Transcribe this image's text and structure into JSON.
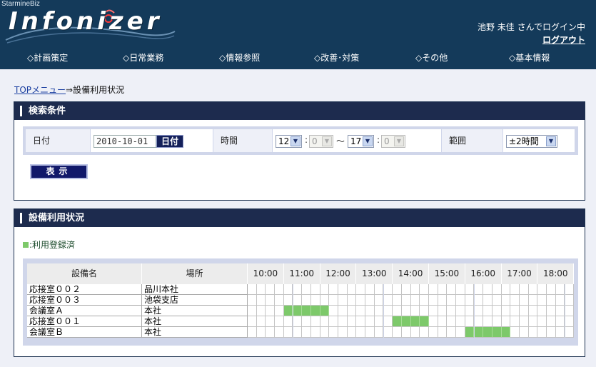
{
  "header": {
    "brand_small": "StarmineBiz",
    "logo_text": "Infonizer",
    "login_status": "池野  未佳 さんでログイン中",
    "logout_label": "ログアウト"
  },
  "nav": {
    "items": [
      {
        "label": "◇計画策定"
      },
      {
        "label": "◇日常業務"
      },
      {
        "label": "◇情報参照"
      },
      {
        "label": "◇改善･対策"
      },
      {
        "label": "◇その他"
      },
      {
        "label": "◇基本情報"
      }
    ]
  },
  "breadcrumb": {
    "link": "TOPメニュー",
    "separator": "⇒",
    "current": "設備利用状況"
  },
  "search": {
    "title": "検索条件",
    "date_label": "日付",
    "date_value": "2010-10-01",
    "date_button": "日付",
    "time_label": "時間",
    "time_from_hour": "12",
    "time_from_min": "0",
    "time_to_hour": "17",
    "time_to_min": "0",
    "time_colon": ":",
    "time_tilde": "〜",
    "range_label": "範囲",
    "range_value": "±2時間",
    "show_button": "表示"
  },
  "status": {
    "title": "設備利用状況",
    "legend": ":利用登録済",
    "columns": {
      "facility": "設備名",
      "location": "場所"
    },
    "hours": [
      "10:00",
      "11:00",
      "12:00",
      "13:00",
      "14:00",
      "15:00",
      "16:00",
      "17:00",
      "18:00"
    ],
    "slots_per_hour": 4,
    "rows": [
      {
        "facility": "応接室００２",
        "location": "品川本社",
        "booked": []
      },
      {
        "facility": "応接室００３",
        "location": "池袋支店",
        "booked": []
      },
      {
        "facility": "会議室Ａ",
        "location": "本社",
        "booked": [
          4,
          5,
          6,
          7,
          8
        ]
      },
      {
        "facility": "応接室００１",
        "location": "本社",
        "booked": [
          16,
          17,
          18,
          19
        ]
      },
      {
        "facility": "会議室Ｂ",
        "location": "本社",
        "booked": [
          24,
          25,
          26,
          27,
          28
        ]
      }
    ]
  },
  "colors": {
    "header_bg": "#143a5a",
    "panel_head_bg": "#1d2b4e",
    "booked": "#7dc96a",
    "button_bg": "#11196a"
  }
}
